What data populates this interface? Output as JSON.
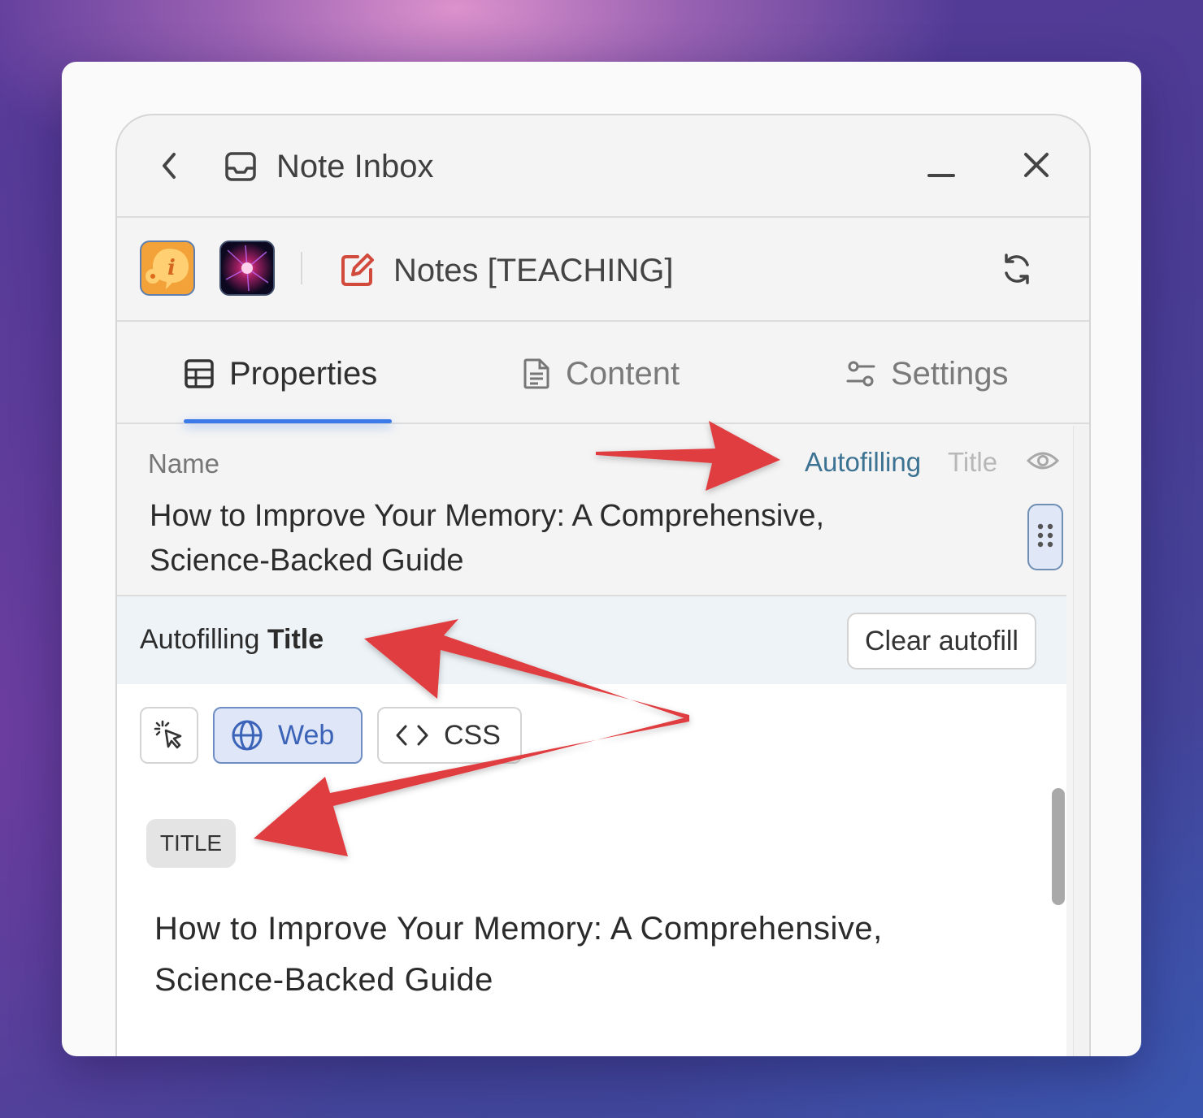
{
  "window": {
    "title": "Note Inbox"
  },
  "toolbar": {
    "note_title": "Notes [TEACHING]"
  },
  "tabs": [
    {
      "label": "Properties",
      "icon": "table-icon",
      "active": true
    },
    {
      "label": "Content",
      "icon": "document-icon",
      "active": false
    },
    {
      "label": "Settings",
      "icon": "sliders-icon",
      "active": false
    }
  ],
  "property": {
    "label": "Name",
    "autofilling_label": "Autofilling",
    "autofill_source": "Title",
    "value_line1": "How to Improve Your Memory: A Comprehensive,",
    "value_line2": "Science-Backed Guide"
  },
  "autofill_panel": {
    "prefix": "Autofilling",
    "field": "Title",
    "clear_label": "Clear autofill",
    "modes": [
      {
        "label": "",
        "icon": "pointer-click-icon",
        "selected": false
      },
      {
        "label": "Web",
        "icon": "globe-icon",
        "selected": true
      },
      {
        "label": "CSS",
        "icon": "code-icon",
        "selected": false
      }
    ],
    "badge": "TITLE",
    "preview_line1": "How to Improve Your Memory: A Comprehensive,",
    "preview_line2": "Science-Backed Guide"
  },
  "colors": {
    "accent_blue": "#3b7ae8",
    "autofill_link": "#3d7392",
    "annotation_red": "#e03c3f",
    "selected_chip_bg": "#dfe6f7"
  }
}
